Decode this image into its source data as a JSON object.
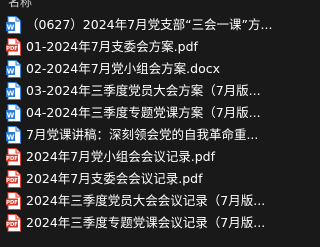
{
  "header": {
    "label": "名称"
  },
  "files": [
    {
      "name": "（0627）2024年7月党支部“三会一课”方...",
      "icon": "word-doc-icon",
      "type": "word"
    },
    {
      "name": "01-2024年7月支委会方案.pdf",
      "icon": "pdf-file-icon",
      "type": "pdf"
    },
    {
      "name": "02-2024年7月党小组会方案.docx",
      "icon": "word-doc-icon",
      "type": "word"
    },
    {
      "name": "03-2024年三季度党员大会方案（7月版...",
      "icon": "word-doc-icon",
      "type": "word"
    },
    {
      "name": "04-2024年三季度专题党课方案（7月版...",
      "icon": "word-doc-icon",
      "type": "word"
    },
    {
      "name": "7月党课讲稿：深刻领会党的自我革命重...",
      "icon": "word-doc-icon",
      "type": "word"
    },
    {
      "name": "2024年7月党小组会会议记录.pdf",
      "icon": "pdf-file-icon",
      "type": "pdf"
    },
    {
      "name": "2024年7月支委会会议记录.pdf",
      "icon": "pdf-file-icon",
      "type": "pdf"
    },
    {
      "name": "2024年三季度党员大会会议记录（7月版...",
      "icon": "pdf-file-icon",
      "type": "pdf"
    },
    {
      "name": "2024年三季度专题党课会议记录（7月版...",
      "icon": "pdf-file-icon",
      "type": "pdf"
    }
  ],
  "colors": {
    "background": "#191919",
    "text": "#ffffff",
    "word_icon": "#2b7cd3",
    "pdf_icon": "#d83b2b"
  }
}
